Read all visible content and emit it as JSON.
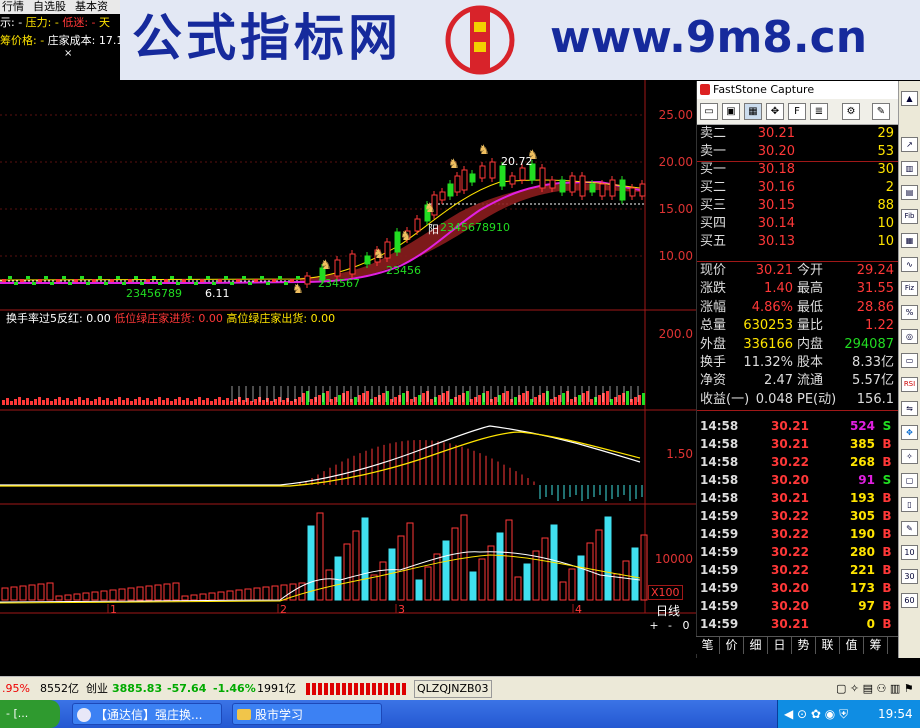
{
  "menubar": {
    "items": [
      "行情",
      "自选股",
      "基本资"
    ]
  },
  "info": {
    "line1_prefix": "示: -",
    "line1_pressure": "压力: -",
    "line1_low": "低迷: -",
    "line1_more": "天",
    "line2_price": "筹价格: -",
    "line2_cost": "庄家成本: 17.1"
  },
  "banner": {
    "text_cn": "公式指标网",
    "url": "www.9m8.cn",
    "logo_text": "tu"
  },
  "price_axis": [
    "25.00",
    "20.00",
    "15.00",
    "10.00"
  ],
  "chart_marks": {
    "peak_label": "20.72",
    "low_label": "6.11",
    "seq1": "23456789",
    "seq2": "2345678910",
    "seq3": "23456",
    "seq4": "234567",
    "yang": "阳"
  },
  "indicator_header": {
    "t1": "换手率过5反红: 0.00",
    "t2": "低位绿庄家进货: 0.00",
    "t3": "高位绿庄家出货: 0.00"
  },
  "indicator_axis": {
    "top": "200.0",
    "macd": "1.50",
    "vol": "10000",
    "vol_unit": "X100"
  },
  "date_axis": [
    "1",
    "2",
    "3",
    "4"
  ],
  "period": "日线",
  "zoom_controls": [
    "+",
    "-",
    "0"
  ],
  "faststone": {
    "title": "FastStone Capture",
    "tools": [
      "▭",
      "▣",
      "▦",
      "✥",
      "F",
      "≣",
      "⚙",
      "✎"
    ]
  },
  "order_book": [
    {
      "label": "卖二",
      "price": "30.21",
      "vol": "29"
    },
    {
      "label": "卖一",
      "price": "30.20",
      "vol": "53"
    },
    {
      "label": "买一",
      "price": "30.18",
      "vol": "30"
    },
    {
      "label": "买二",
      "price": "30.16",
      "vol": "2"
    },
    {
      "label": "买三",
      "price": "30.15",
      "vol": "88"
    },
    {
      "label": "买四",
      "price": "30.14",
      "vol": "10"
    },
    {
      "label": "买五",
      "price": "30.13",
      "vol": "10"
    }
  ],
  "stats": [
    {
      "l1": "现价",
      "v1": "30.21",
      "l2": "今开",
      "v2": "29.24"
    },
    {
      "l1": "涨跌",
      "v1": "1.40",
      "l2": "最高",
      "v2": "31.55"
    },
    {
      "l1": "涨幅",
      "v1": "4.86%",
      "l2": "最低",
      "v2": "28.86"
    },
    {
      "l1": "总量",
      "v1": "630253",
      "l2": "量比",
      "v2": "1.22"
    },
    {
      "l1": "外盘",
      "v1": "336166",
      "l2": "内盘",
      "v2": "294087"
    },
    {
      "l1": "换手",
      "v1": "11.32%",
      "l2": "股本",
      "v2": "8.33亿"
    },
    {
      "l1": "净资",
      "v1": "2.47",
      "l2": "流通",
      "v2": "5.57亿"
    },
    {
      "l1": "收益(一)",
      "v1": "0.048",
      "l2": "PE(动)",
      "v2": "156.1"
    }
  ],
  "ticks": [
    {
      "time": "14:58",
      "price": "30.21",
      "vol": "524",
      "dir": "S"
    },
    {
      "time": "14:58",
      "price": "30.21",
      "vol": "385",
      "dir": "B"
    },
    {
      "time": "14:58",
      "price": "30.22",
      "vol": "268",
      "dir": "B"
    },
    {
      "time": "14:58",
      "price": "30.20",
      "vol": "91",
      "dir": "S"
    },
    {
      "time": "14:58",
      "price": "30.21",
      "vol": "193",
      "dir": "B"
    },
    {
      "time": "14:59",
      "price": "30.22",
      "vol": "305",
      "dir": "B"
    },
    {
      "time": "14:59",
      "price": "30.22",
      "vol": "190",
      "dir": "B"
    },
    {
      "time": "14:59",
      "price": "30.22",
      "vol": "280",
      "dir": "B"
    },
    {
      "time": "14:59",
      "price": "30.22",
      "vol": "221",
      "dir": "B"
    },
    {
      "time": "14:59",
      "price": "30.20",
      "vol": "173",
      "dir": "B"
    },
    {
      "time": "14:59",
      "price": "30.20",
      "vol": "97",
      "dir": "B"
    },
    {
      "time": "14:59",
      "price": "30.21",
      "vol": "0",
      "dir": "B"
    }
  ],
  "bottom_tabs": [
    "笔",
    "价",
    "细",
    "日",
    "势",
    "联",
    "值",
    "筹"
  ],
  "vertical_tools": [
    "RSI",
    "Fib",
    "Fiz",
    "10",
    "30",
    "60"
  ],
  "statusbar": {
    "pct1": ".95%",
    "amount1": "8552亿",
    "idx_name": "创业",
    "idx_value": "3885.83",
    "idx_change": "-57.64",
    "idx_pct": "-1.46%",
    "idx_amount": "1991亿",
    "code": "QLZQJNZB03"
  },
  "taskbar": {
    "start": "- [...",
    "btn1": "【通达信】强庄换...",
    "btn2": "股市学习",
    "clock": "19:54"
  },
  "colors": {
    "up": "#ff3838",
    "down": "#22dd22",
    "yellow": "#ffe400",
    "banner_text": "#162a9c"
  }
}
